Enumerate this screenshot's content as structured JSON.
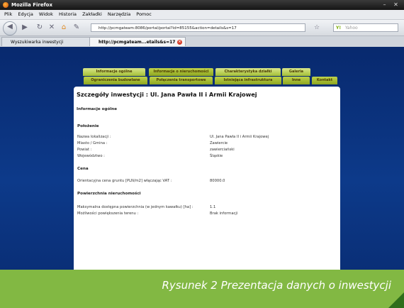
{
  "window": {
    "title": "Mozilla Firefox"
  },
  "menu": [
    "Plik",
    "Edycja",
    "Widok",
    "Historia",
    "Zakładki",
    "Narzędzia",
    "Pomoc"
  ],
  "address_bar": {
    "url": "http://pcmgateam:8086/portal/portal?id=85155&action=details&s=17"
  },
  "search_box": {
    "placeholder": "Yahoo"
  },
  "tabs": [
    {
      "label": "Wyszukiwarka inwestycji"
    },
    {
      "label": "http://pcmgateam...etails&s=17"
    }
  ],
  "nav_tabs_row1": [
    "Informacje ogólne",
    "Informacje o nieruchomości",
    "Charakterystyka działki",
    "Galeria"
  ],
  "nav_tabs_row2": [
    "Ograniczenia budowlane",
    "Połączenia transportowe",
    "Istniejąca infrastruktura",
    "Inne",
    "Kontakt"
  ],
  "page": {
    "title": "Szczegóły inwestycji : Ul. Jana Pawła II i Armii Krajowej",
    "section_general": "Informacje ogólne",
    "section_location": "Położenie",
    "location": [
      {
        "label": "Nazwa lokalizacji :",
        "value": "Ul. Jana Pawła II i Armii Krajowej"
      },
      {
        "label": "Miasto / Gmina :",
        "value": "Zawiercie"
      },
      {
        "label": "Powiat :",
        "value": "zawierciański"
      },
      {
        "label": "Województwo :",
        "value": "Śląskie"
      }
    ],
    "section_price": "Cena",
    "price": {
      "label": "Orientacyjna cena gruntu [PLN/m2] włączając VAT :",
      "value": "80000.0"
    },
    "section_area": "Powierzchnia nieruchomości",
    "area": [
      {
        "label": "Maksymalna dostępna powierzchnia (w jednym kawałku) [ha] :",
        "value": "1.1"
      },
      {
        "label": "Możliwości powiększenia terenu :",
        "value": "Brak informacji"
      }
    ]
  },
  "caption": "Rysunek 2 Prezentacja danych o inwestycji"
}
